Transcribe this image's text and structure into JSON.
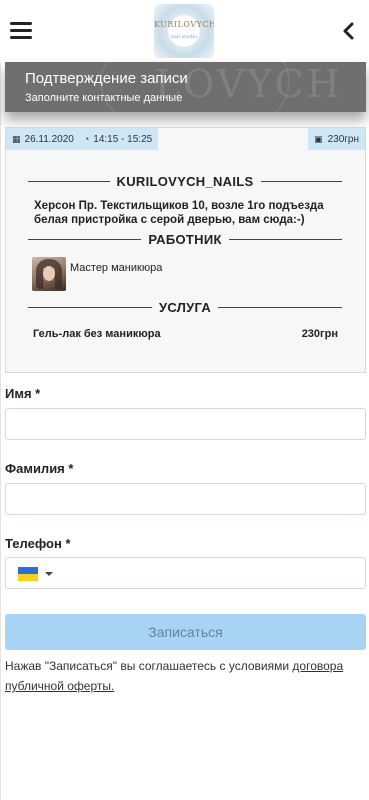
{
  "header": {
    "menu_icon": "hamburger-icon",
    "back_icon": "chevron-left-icon",
    "logo_text": "KURILOVYCH",
    "logo_sub": "nail studio"
  },
  "banner": {
    "title": "Подтверждение записи",
    "subtitle": "Заполните контактные данные",
    "watermark": "LOVYCH"
  },
  "booking": {
    "date": "26.11.2020",
    "time": "14:15 - 15:25",
    "price_chip": "230грн",
    "salon_heading": "KURILOVYCH_NAILS",
    "address": "Херсон Пр. Текстильщиков 10, возле 1го подъезда белая пристройка с серой дверью, вам сюда:-)",
    "worker_heading": "РАБОТНИК",
    "worker_name": "Мастер маникюра",
    "service_heading": "УСЛУГА",
    "service_name": "Гель-лак без маникюра",
    "service_price": "230грн"
  },
  "form": {
    "first_name_label": "Имя",
    "last_name_label": "Фамилия",
    "phone_label": "Телефон",
    "required_mark": "*",
    "first_name_value": "",
    "last_name_value": "",
    "phone_value": "",
    "phone_country": "UA",
    "submit_label": "Записаться"
  },
  "terms": {
    "text": "Нажав \"Записаться\" вы соглашаетесь с условиями",
    "link": "договора публичной оферты."
  },
  "colors": {
    "chip_bg": "#cfe6f7",
    "submit_bg": "#a8d4f3",
    "submit_text": "#5b86a6",
    "banner_bg": "#6f6f6f"
  }
}
